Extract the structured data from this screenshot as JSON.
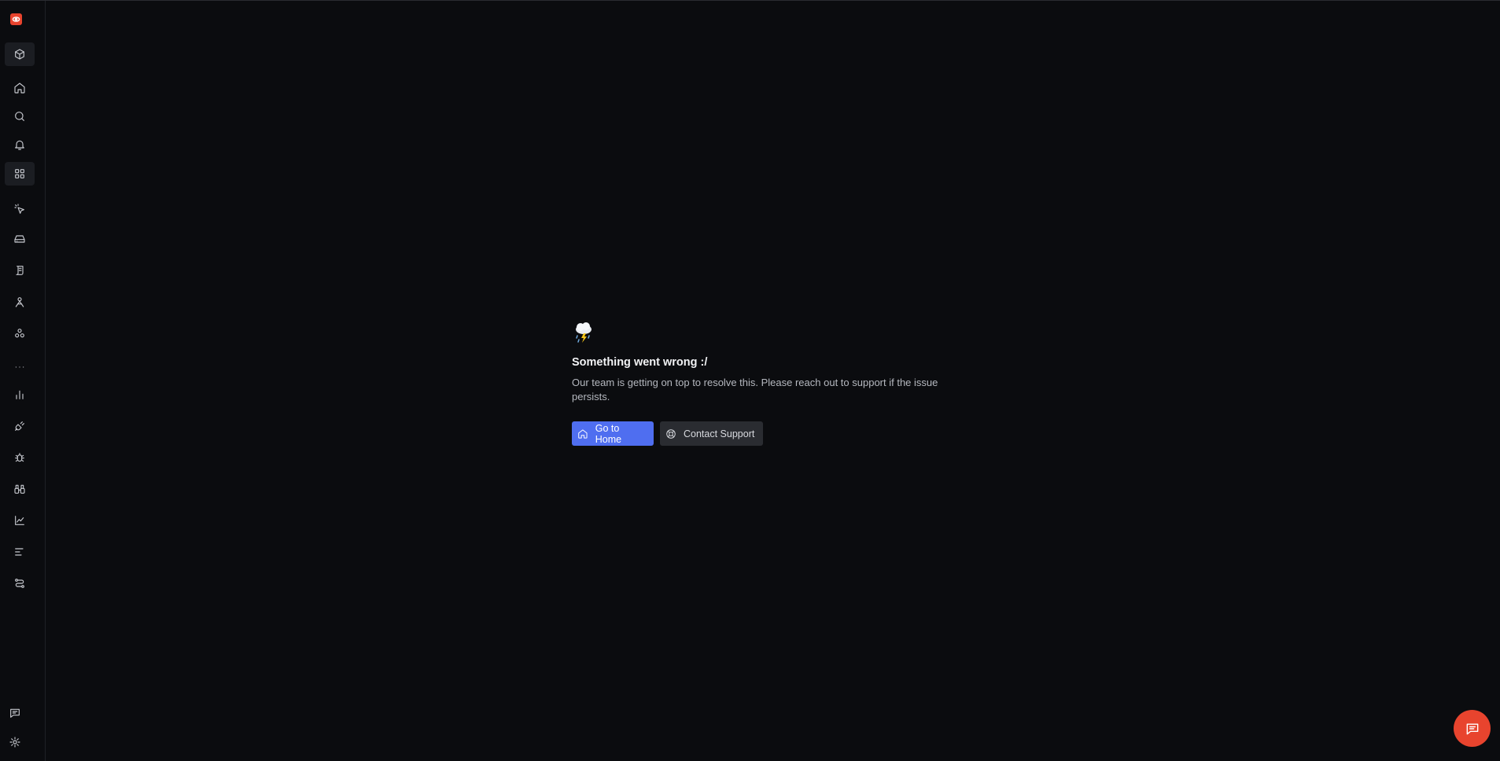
{
  "sidebar": {
    "logo_icon": "eye-logo-icon",
    "items": [
      {
        "name": "packages",
        "icon": "cube-icon",
        "active": true
      },
      {
        "name": "home",
        "icon": "home-icon",
        "active": false
      },
      {
        "name": "search",
        "icon": "search-icon",
        "active": false
      },
      {
        "name": "alerts",
        "icon": "bell-icon",
        "active": false
      },
      {
        "name": "dashboards",
        "icon": "grid-icon",
        "active": true
      },
      {
        "name": "sparkles",
        "icon": "cursor-sparkle-icon",
        "active": false
      },
      {
        "name": "storage",
        "icon": "hard-drive-icon",
        "active": false
      },
      {
        "name": "logs",
        "icon": "scroll-icon",
        "active": false
      },
      {
        "name": "users",
        "icon": "user-sign-icon",
        "active": false
      },
      {
        "name": "workflows",
        "icon": "nodes-icon",
        "active": false
      },
      {
        "name": "more",
        "icon": "ellipsis-icon",
        "active": false
      },
      {
        "name": "metrics",
        "icon": "bar-chart-icon",
        "active": false
      },
      {
        "name": "integrations",
        "icon": "plug-icon",
        "active": false
      },
      {
        "name": "exceptions",
        "icon": "bug-icon",
        "active": false
      },
      {
        "name": "monitoring",
        "icon": "binoculars-icon",
        "active": false
      },
      {
        "name": "analytics",
        "icon": "line-chart-icon",
        "active": false
      },
      {
        "name": "traces",
        "icon": "align-left-icon",
        "active": false
      },
      {
        "name": "pipelines",
        "icon": "route-icon",
        "active": false
      },
      {
        "name": "feedback",
        "icon": "message-icon",
        "active": false
      },
      {
        "name": "settings",
        "icon": "gear-icon",
        "active": false
      }
    ]
  },
  "error": {
    "icon": "storm-cloud-icon",
    "title": "Something went wrong :/",
    "description": "Our team is getting on top to resolve this. Please reach out to support if the issue persists.",
    "primary_button": "Go to Home",
    "secondary_button": "Contact Support"
  },
  "chat_fab": {
    "icon": "chat-icon"
  },
  "colors": {
    "background": "#0b0c0f",
    "accent": "#4f6ef0",
    "brand": "#e8442e",
    "secondary_button": "#2a2c31"
  }
}
